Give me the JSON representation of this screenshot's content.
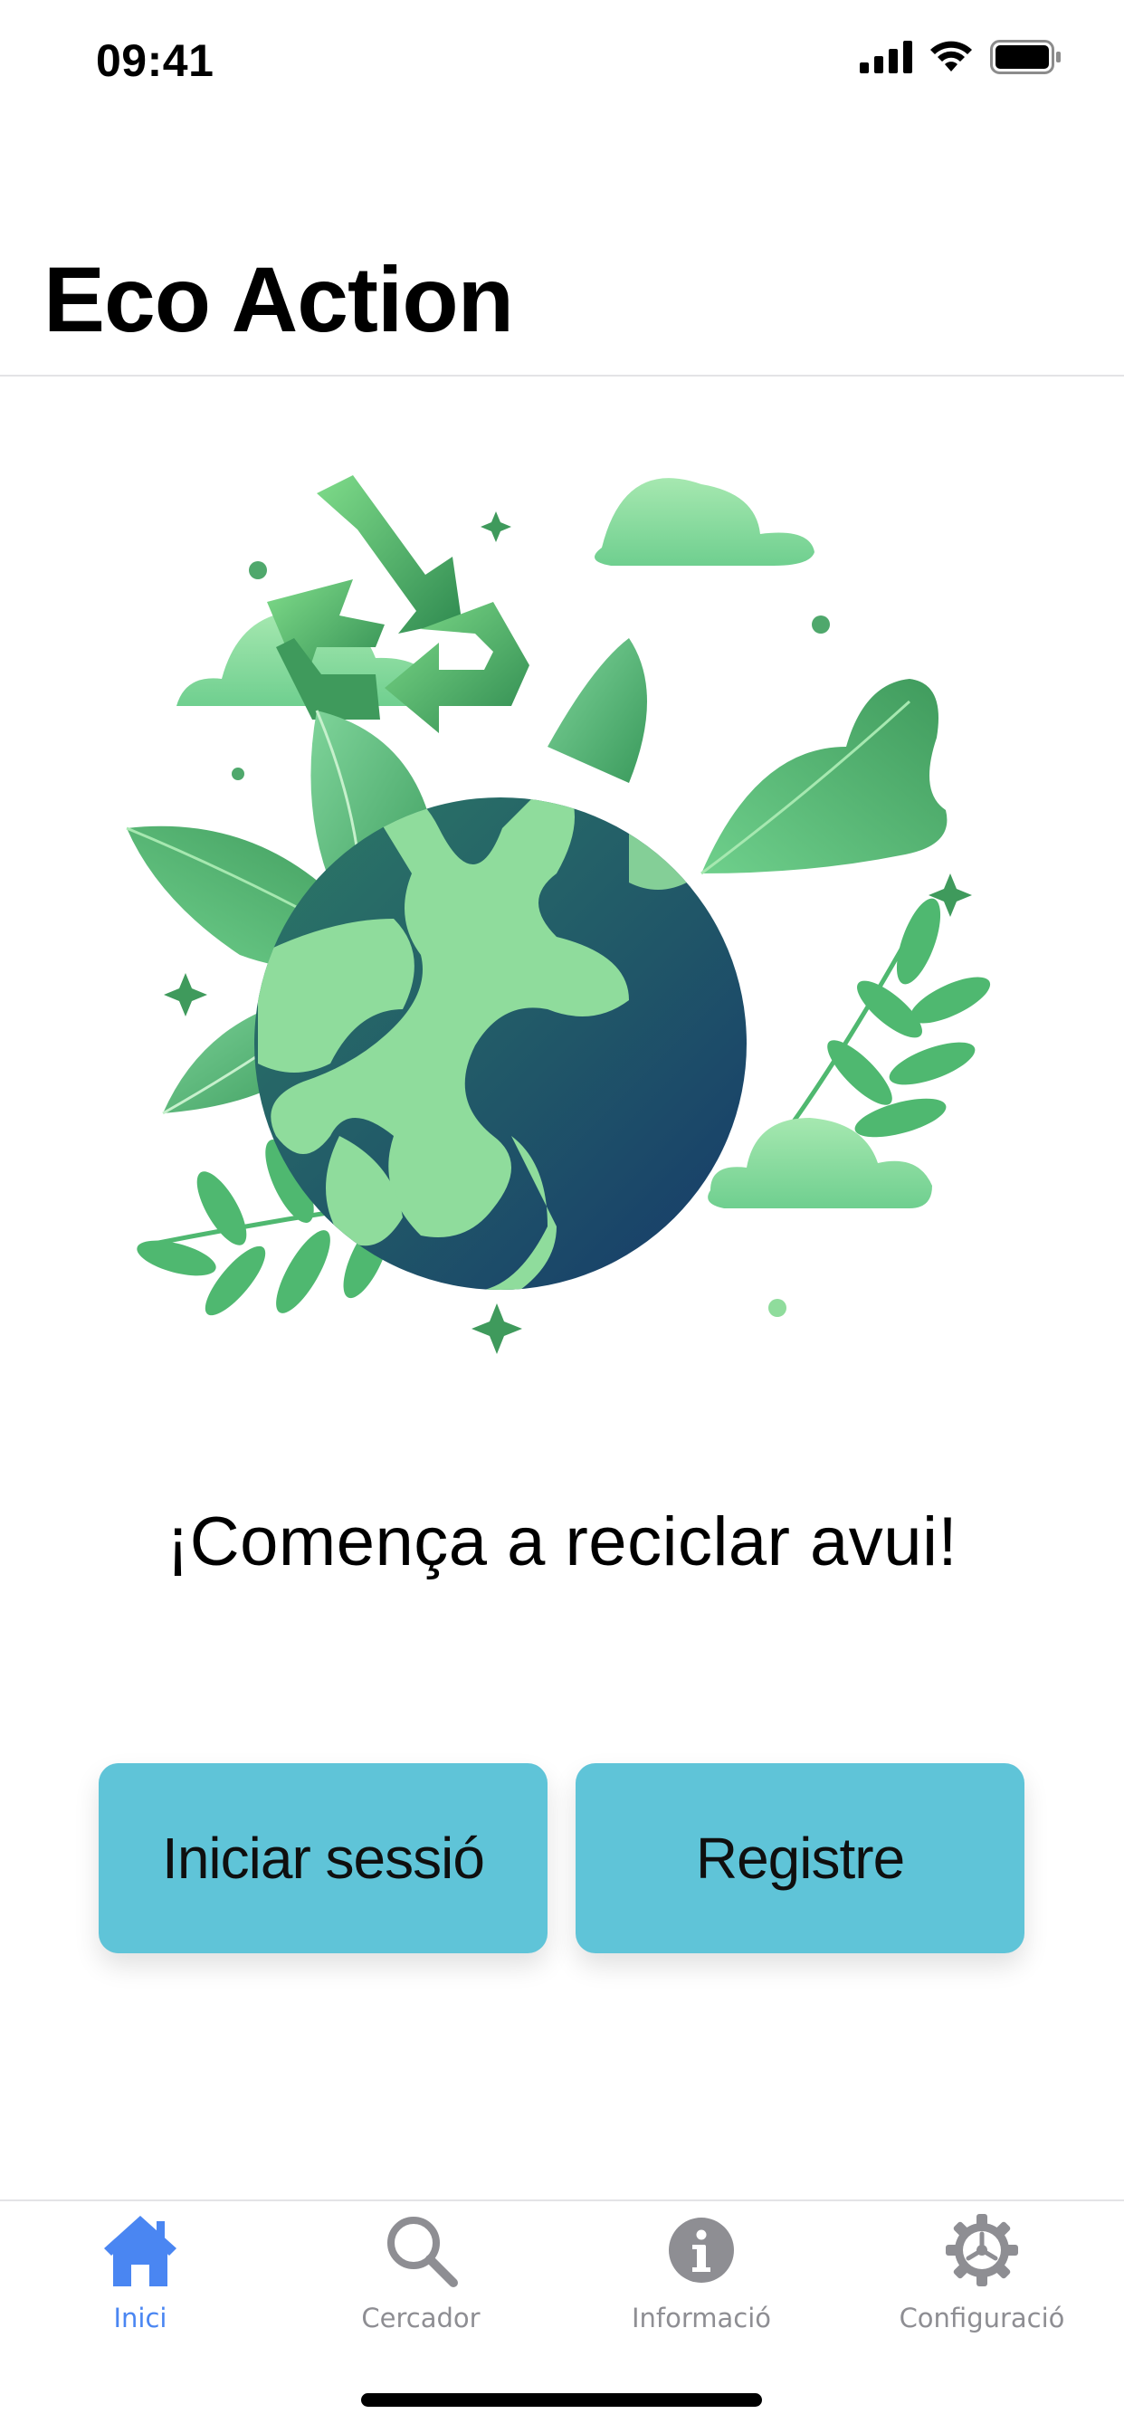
{
  "status_bar": {
    "time": "09:41",
    "icons": [
      "signal-icon",
      "wifi-icon",
      "battery-icon"
    ]
  },
  "nav": {
    "title": "Eco Action"
  },
  "hero": {
    "illustration": "earth-recycling-illustration"
  },
  "main": {
    "headline": "¡Comença a reciclar avui!",
    "login_label": "Iniciar sessió",
    "register_label": "Registre"
  },
  "tabs": [
    {
      "label": "Inici",
      "icon": "home-icon",
      "active": true
    },
    {
      "label": "Cercador",
      "icon": "search-icon",
      "active": false
    },
    {
      "label": "Informació",
      "icon": "info-icon",
      "active": false
    },
    {
      "label": "Configuració",
      "icon": "gear-icon",
      "active": false
    }
  ],
  "colors": {
    "button": "#5fc4d8",
    "tab_active": "#4a86f2",
    "tab_inactive": "#8e8e93",
    "earth_ocean": "#1e4a6e",
    "earth_land": "#8fdc9c"
  }
}
